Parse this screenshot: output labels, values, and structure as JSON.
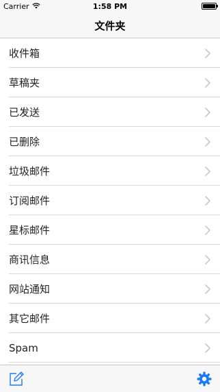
{
  "status_bar": {
    "carrier": "Carrier",
    "time": "1:58 PM",
    "battery_level": 1.0
  },
  "nav": {
    "title": "文件夹"
  },
  "folders": [
    {
      "label": "收件箱"
    },
    {
      "label": "草稿夹"
    },
    {
      "label": "已发送"
    },
    {
      "label": "已删除"
    },
    {
      "label": "垃圾邮件"
    },
    {
      "label": "订阅邮件"
    },
    {
      "label": "星标邮件"
    },
    {
      "label": "商讯信息"
    },
    {
      "label": "网站通知"
    },
    {
      "label": "其它邮件"
    },
    {
      "label": "Spam"
    }
  ],
  "icons": {
    "wifi": "wifi-icon",
    "battery": "battery-icon",
    "chevron": "chevron-right-icon",
    "compose": "compose-icon",
    "settings": "gear-icon"
  },
  "colors": {
    "accent": "#1a7cf5",
    "chevron": "#c7c7cc"
  }
}
